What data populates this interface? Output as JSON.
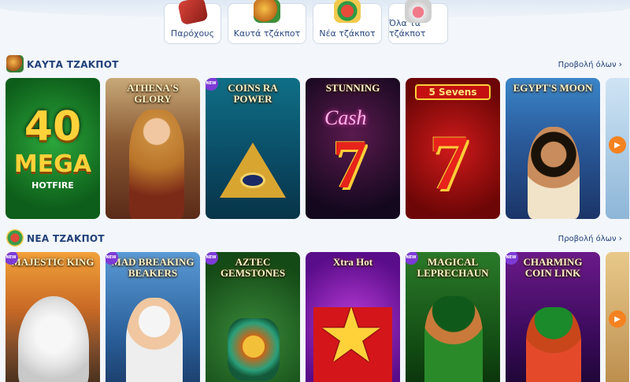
{
  "categories": [
    {
      "label": "Παρόχους",
      "icon": "providers-book-icon"
    },
    {
      "label": "Καυτά τζάκποτ",
      "icon": "hot-barrel-icon"
    },
    {
      "label": "Νέα τζάκποτ",
      "icon": "new-ornament-icon"
    },
    {
      "label": "Όλα τα τζάκποτ",
      "icon": "all-sushi-icon"
    }
  ],
  "hot": {
    "title": "ΚΑΥΤΑ ΤΖΑΚΠΟΤ",
    "view_all": "Προβολή όλων",
    "games": [
      {
        "name": "40 Mega Hotfire",
        "line1": "40",
        "line2": "MEGA",
        "line3": "HOTFIRE"
      },
      {
        "name": "Athena's Glory",
        "title": "ATHENA'S GLORY"
      },
      {
        "name": "Coins of Ra Power",
        "title": "COINS RA POWER",
        "badge": "NEW"
      },
      {
        "name": "Stunning Cash",
        "title": "STUNNING",
        "sub": "Cash"
      },
      {
        "name": "5 Sevens",
        "title": "5 Sevens"
      },
      {
        "name": "Egypt's Moon",
        "title": "EGYPT'S MOON"
      }
    ]
  },
  "newj": {
    "title": "ΝΕΑ ΤΖΑΚΠΟΤ",
    "view_all": "Προβολή όλων",
    "games": [
      {
        "name": "Majestic King",
        "title": "MAJESTIC KING",
        "badge": "NEW"
      },
      {
        "name": "Mad Scientist Breaking Beakers",
        "title": "MAD BREAKING BEAKERS",
        "badge": "NEW"
      },
      {
        "name": "Aztec Gemstones",
        "title": "AZTEC GEMSTONES",
        "badge": "NEW"
      },
      {
        "name": "Xtra Hot",
        "title": "Xtra Hot"
      },
      {
        "name": "Magical Leprechaun",
        "title": "MAGICAL LEPRECHAUN",
        "badge": "NEW"
      },
      {
        "name": "Charming Coin Link",
        "title": "CHARMING COIN LINK",
        "badge": "NEW"
      }
    ]
  }
}
